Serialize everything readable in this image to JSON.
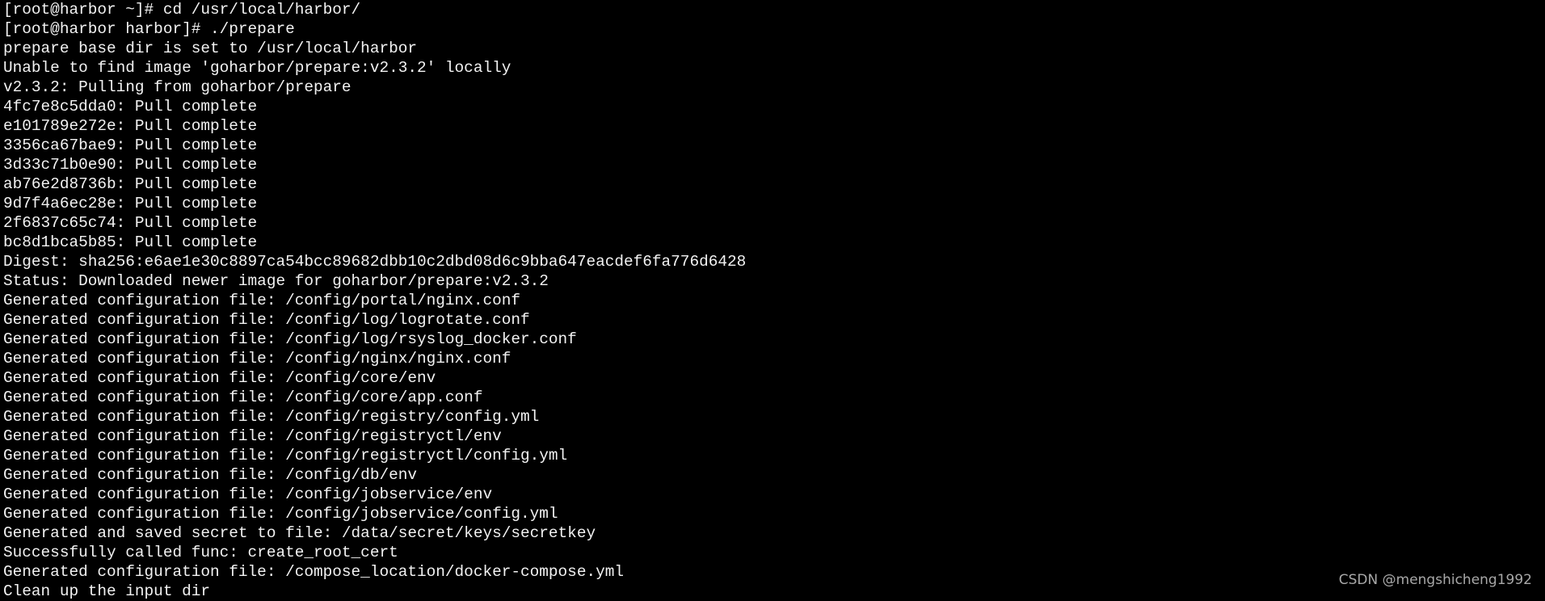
{
  "terminal": {
    "lines": [
      "[root@harbor ~]# cd /usr/local/harbor/",
      "[root@harbor harbor]# ./prepare",
      "prepare base dir is set to /usr/local/harbor",
      "Unable to find image 'goharbor/prepare:v2.3.2' locally",
      "v2.3.2: Pulling from goharbor/prepare",
      "4fc7e8c5dda0: Pull complete",
      "e101789e272e: Pull complete",
      "3356ca67bae9: Pull complete",
      "3d33c71b0e90: Pull complete",
      "ab76e2d8736b: Pull complete",
      "9d7f4a6ec28e: Pull complete",
      "2f6837c65c74: Pull complete",
      "bc8d1bca5b85: Pull complete",
      "Digest: sha256:e6ae1e30c8897ca54bcc89682dbb10c2dbd08d6c9bba647eacdef6fa776d6428",
      "Status: Downloaded newer image for goharbor/prepare:v2.3.2",
      "Generated configuration file: /config/portal/nginx.conf",
      "Generated configuration file: /config/log/logrotate.conf",
      "Generated configuration file: /config/log/rsyslog_docker.conf",
      "Generated configuration file: /config/nginx/nginx.conf",
      "Generated configuration file: /config/core/env",
      "Generated configuration file: /config/core/app.conf",
      "Generated configuration file: /config/registry/config.yml",
      "Generated configuration file: /config/registryctl/env",
      "Generated configuration file: /config/registryctl/config.yml",
      "Generated configuration file: /config/db/env",
      "Generated configuration file: /config/jobservice/env",
      "Generated configuration file: /config/jobservice/config.yml",
      "Generated and saved secret to file: /data/secret/keys/secretkey",
      "Successfully called func: create_root_cert",
      "Generated configuration file: /compose_location/docker-compose.yml",
      "Clean up the input dir"
    ]
  },
  "watermark": "CSDN @mengshicheng1992"
}
